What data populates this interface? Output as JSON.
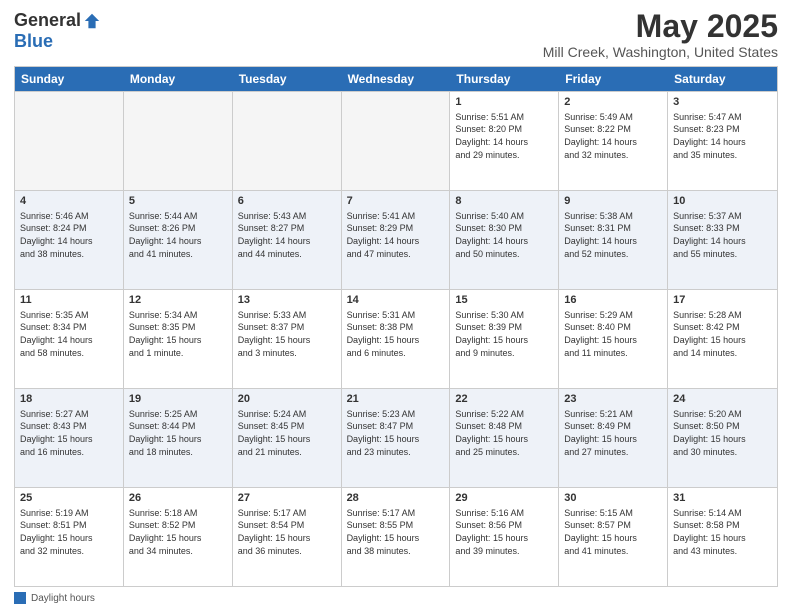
{
  "header": {
    "logo_general": "General",
    "logo_blue": "Blue",
    "month_title": "May 2025",
    "location": "Mill Creek, Washington, United States"
  },
  "days_of_week": [
    "Sunday",
    "Monday",
    "Tuesday",
    "Wednesday",
    "Thursday",
    "Friday",
    "Saturday"
  ],
  "weeks": [
    [
      {
        "day": "",
        "info": "",
        "empty": true
      },
      {
        "day": "",
        "info": "",
        "empty": true
      },
      {
        "day": "",
        "info": "",
        "empty": true
      },
      {
        "day": "",
        "info": "",
        "empty": true
      },
      {
        "day": "1",
        "info": "Sunrise: 5:51 AM\nSunset: 8:20 PM\nDaylight: 14 hours\nand 29 minutes."
      },
      {
        "day": "2",
        "info": "Sunrise: 5:49 AM\nSunset: 8:22 PM\nDaylight: 14 hours\nand 32 minutes."
      },
      {
        "day": "3",
        "info": "Sunrise: 5:47 AM\nSunset: 8:23 PM\nDaylight: 14 hours\nand 35 minutes."
      }
    ],
    [
      {
        "day": "4",
        "info": "Sunrise: 5:46 AM\nSunset: 8:24 PM\nDaylight: 14 hours\nand 38 minutes."
      },
      {
        "day": "5",
        "info": "Sunrise: 5:44 AM\nSunset: 8:26 PM\nDaylight: 14 hours\nand 41 minutes."
      },
      {
        "day": "6",
        "info": "Sunrise: 5:43 AM\nSunset: 8:27 PM\nDaylight: 14 hours\nand 44 minutes."
      },
      {
        "day": "7",
        "info": "Sunrise: 5:41 AM\nSunset: 8:29 PM\nDaylight: 14 hours\nand 47 minutes."
      },
      {
        "day": "8",
        "info": "Sunrise: 5:40 AM\nSunset: 8:30 PM\nDaylight: 14 hours\nand 50 minutes."
      },
      {
        "day": "9",
        "info": "Sunrise: 5:38 AM\nSunset: 8:31 PM\nDaylight: 14 hours\nand 52 minutes."
      },
      {
        "day": "10",
        "info": "Sunrise: 5:37 AM\nSunset: 8:33 PM\nDaylight: 14 hours\nand 55 minutes."
      }
    ],
    [
      {
        "day": "11",
        "info": "Sunrise: 5:35 AM\nSunset: 8:34 PM\nDaylight: 14 hours\nand 58 minutes."
      },
      {
        "day": "12",
        "info": "Sunrise: 5:34 AM\nSunset: 8:35 PM\nDaylight: 15 hours\nand 1 minute."
      },
      {
        "day": "13",
        "info": "Sunrise: 5:33 AM\nSunset: 8:37 PM\nDaylight: 15 hours\nand 3 minutes."
      },
      {
        "day": "14",
        "info": "Sunrise: 5:31 AM\nSunset: 8:38 PM\nDaylight: 15 hours\nand 6 minutes."
      },
      {
        "day": "15",
        "info": "Sunrise: 5:30 AM\nSunset: 8:39 PM\nDaylight: 15 hours\nand 9 minutes."
      },
      {
        "day": "16",
        "info": "Sunrise: 5:29 AM\nSunset: 8:40 PM\nDaylight: 15 hours\nand 11 minutes."
      },
      {
        "day": "17",
        "info": "Sunrise: 5:28 AM\nSunset: 8:42 PM\nDaylight: 15 hours\nand 14 minutes."
      }
    ],
    [
      {
        "day": "18",
        "info": "Sunrise: 5:27 AM\nSunset: 8:43 PM\nDaylight: 15 hours\nand 16 minutes."
      },
      {
        "day": "19",
        "info": "Sunrise: 5:25 AM\nSunset: 8:44 PM\nDaylight: 15 hours\nand 18 minutes."
      },
      {
        "day": "20",
        "info": "Sunrise: 5:24 AM\nSunset: 8:45 PM\nDaylight: 15 hours\nand 21 minutes."
      },
      {
        "day": "21",
        "info": "Sunrise: 5:23 AM\nSunset: 8:47 PM\nDaylight: 15 hours\nand 23 minutes."
      },
      {
        "day": "22",
        "info": "Sunrise: 5:22 AM\nSunset: 8:48 PM\nDaylight: 15 hours\nand 25 minutes."
      },
      {
        "day": "23",
        "info": "Sunrise: 5:21 AM\nSunset: 8:49 PM\nDaylight: 15 hours\nand 27 minutes."
      },
      {
        "day": "24",
        "info": "Sunrise: 5:20 AM\nSunset: 8:50 PM\nDaylight: 15 hours\nand 30 minutes."
      }
    ],
    [
      {
        "day": "25",
        "info": "Sunrise: 5:19 AM\nSunset: 8:51 PM\nDaylight: 15 hours\nand 32 minutes."
      },
      {
        "day": "26",
        "info": "Sunrise: 5:18 AM\nSunset: 8:52 PM\nDaylight: 15 hours\nand 34 minutes."
      },
      {
        "day": "27",
        "info": "Sunrise: 5:17 AM\nSunset: 8:54 PM\nDaylight: 15 hours\nand 36 minutes."
      },
      {
        "day": "28",
        "info": "Sunrise: 5:17 AM\nSunset: 8:55 PM\nDaylight: 15 hours\nand 38 minutes."
      },
      {
        "day": "29",
        "info": "Sunrise: 5:16 AM\nSunset: 8:56 PM\nDaylight: 15 hours\nand 39 minutes."
      },
      {
        "day": "30",
        "info": "Sunrise: 5:15 AM\nSunset: 8:57 PM\nDaylight: 15 hours\nand 41 minutes."
      },
      {
        "day": "31",
        "info": "Sunrise: 5:14 AM\nSunset: 8:58 PM\nDaylight: 15 hours\nand 43 minutes."
      }
    ]
  ],
  "footer": {
    "legend_label": "Daylight hours"
  }
}
